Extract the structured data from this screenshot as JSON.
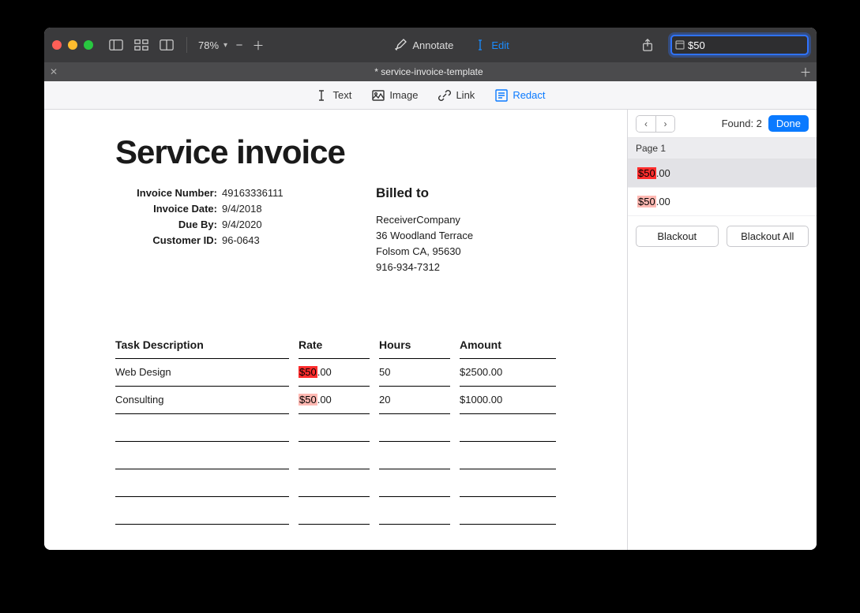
{
  "toolbar": {
    "zoom": "78%",
    "annotate": "Annotate",
    "edit": "Edit"
  },
  "search": {
    "value": "$50"
  },
  "tab": {
    "title": "* service-invoice-template"
  },
  "anno": {
    "text": "Text",
    "image": "Image",
    "link": "Link",
    "redact": "Redact"
  },
  "sidepanel": {
    "found_label": "Found: 2",
    "done": "Done",
    "page_label": "Page 1",
    "results": [
      {
        "prefix": "$50",
        "suffix": ".00",
        "selected": true
      },
      {
        "prefix": "$50",
        "suffix": ".00",
        "selected": false
      }
    ],
    "blackout": "Blackout",
    "blackout_all": "Blackout All"
  },
  "invoice": {
    "title": "Service invoice",
    "labels": {
      "number": "Invoice Number:",
      "date": "Invoice Date:",
      "due": "Due By:",
      "customer": "Customer ID:"
    },
    "values": {
      "number": "49163336111",
      "date": "9/4/2018",
      "due": "9/4/2020",
      "customer": "96-0643"
    },
    "billed_to_label": "Billed to",
    "billed": {
      "name": "ReceiverCompany",
      "street": "36 Woodland Terrace",
      "city": "Folsom CA, 95630",
      "phone": "916-934-7312"
    },
    "columns": {
      "desc": "Task Description",
      "rate": "Rate",
      "hours": "Hours",
      "amount": "Amount"
    },
    "rows": [
      {
        "desc": "Web Design",
        "rate_hl": "$50",
        "rate_rest": ".00",
        "hours": "50",
        "amount": "$2500.00",
        "hl": "strong"
      },
      {
        "desc": "Consulting",
        "rate_hl": "$50",
        "rate_rest": ".00",
        "hours": "20",
        "amount": "$1000.00",
        "hl": "soft"
      }
    ]
  }
}
